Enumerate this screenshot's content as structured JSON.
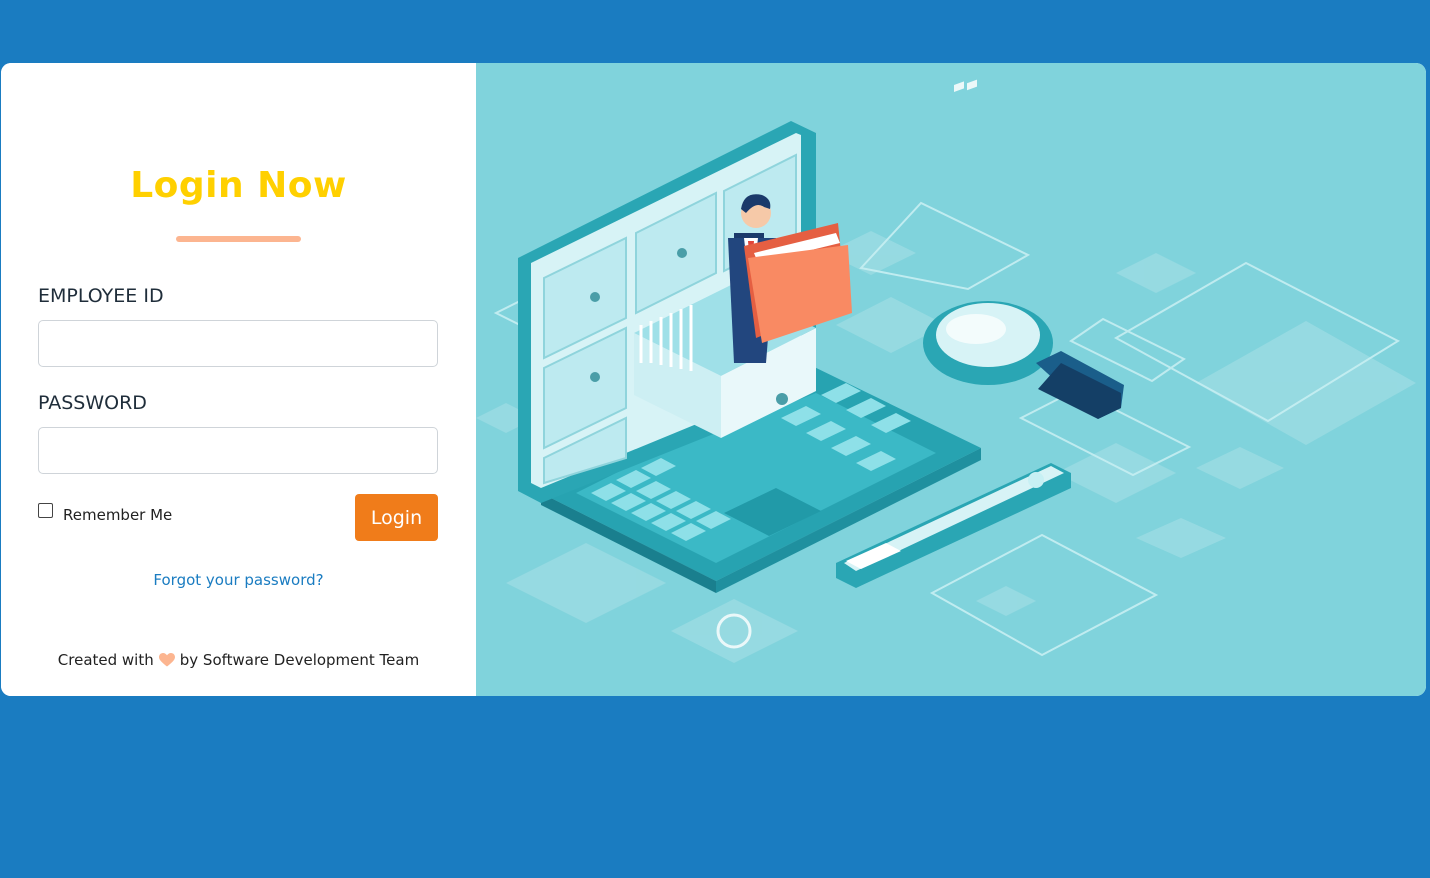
{
  "login": {
    "title": "Login Now",
    "employee_id_label": "EMPLOYEE ID",
    "employee_id_value": "",
    "password_label": "PASSWORD",
    "password_value": "",
    "remember_label": "Remember Me",
    "remember_checked": false,
    "login_button": "Login",
    "forgot_link": "Forgot your password?"
  },
  "footer": {
    "prefix": "Created with",
    "icon": "heart-icon",
    "suffix": "by Software Development Team"
  },
  "colors": {
    "page_background": "#1a7cc1",
    "title": "#ffd000",
    "title_underline": "#fcb590",
    "login_button": "#f07c1a",
    "link": "#1a7cc1",
    "heart": "#fcb590",
    "illustration_background": "#80d3dc"
  },
  "illustration": {
    "icon": "laptop-file-cabinet-illustration"
  }
}
